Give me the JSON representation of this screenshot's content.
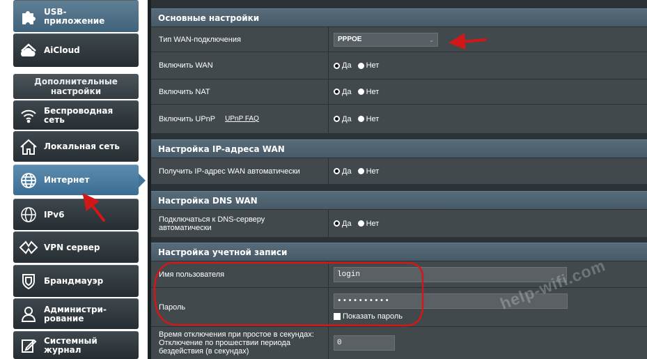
{
  "sidebar": {
    "items": [
      {
        "label": "USB-\nприложение",
        "icon": "puzzle-icon"
      },
      {
        "label": "AiCloud",
        "icon": "cloud-icon"
      },
      {
        "label": "Беспроводная\nсеть",
        "icon": "wifi-icon"
      },
      {
        "label": "Локальная сеть",
        "icon": "home-icon"
      },
      {
        "label": "Интернет",
        "icon": "globe-icon"
      },
      {
        "label": "IPv6",
        "icon": "ipv6-globe-icon"
      },
      {
        "label": "VPN сервер",
        "icon": "vpn-icon"
      },
      {
        "label": "Брандмауэр",
        "icon": "shield-icon"
      },
      {
        "label": "Администри-\nрование",
        "icon": "user-icon"
      },
      {
        "label": "Системный\nжурнал",
        "icon": "log-icon"
      }
    ],
    "section_title": "Дополнительные\nнастройки",
    "active": "Интернет"
  },
  "main": {
    "basic": {
      "header": "Основные настройки",
      "wan_type_label": "Тип WAN-подключения",
      "wan_type_value": "PPPOE",
      "enable_wan_label": "Включить WAN",
      "enable_nat_label": "Включить NAT",
      "enable_upnp_label": "Включить UPnP",
      "upnp_faq": "UPnP  FAQ"
    },
    "ip": {
      "header": "Настройка IP-адреса WAN",
      "auto_ip_label": "Получить IP-адрес WAN автоматически"
    },
    "dns": {
      "header": "Настройка DNS WAN",
      "auto_dns_label": "Подключаться к DNS-серверу\nавтоматически"
    },
    "account": {
      "header": "Настройка учетной записи",
      "username_label": "Имя пользователя",
      "username_value": "login",
      "password_label": "Пароль",
      "password_value": "••••••••••",
      "show_password_label": "Показать пароль",
      "idle_label": "Время отключения при простое в секундах:\nОтключение по прошествии периода\nбездействия (в секундах)",
      "idle_value": "0"
    },
    "radio": {
      "yes": "Да",
      "no": "Нет"
    }
  },
  "watermark": "help-wifi.com",
  "colors": {
    "annotation": "#d01818",
    "active_item": "#447599",
    "header": "#516575",
    "row": "#42494d"
  }
}
